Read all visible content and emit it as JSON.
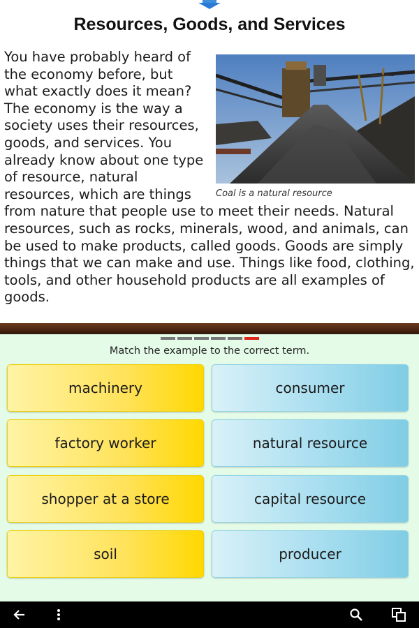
{
  "article": {
    "title": "Resources, Goods, and Services",
    "body": "You have probably heard of the economy before, but what exactly does it mean? The economy is the way a society uses their resources, goods, and services. You already know about one type of resource, natural resources, which are things from nature that people use to meet their needs. Natural resources, such as rocks, minerals, wood, and animals, can be used to make products, called goods. Goods are simply things that we can make and use. Things like food, clothing, tools, and other household products are all examples of goods.",
    "image_caption": "Coal is a natural resource"
  },
  "quiz": {
    "progress": {
      "total": 6,
      "current": 6
    },
    "instruction": "Match the example to the correct term.",
    "examples": [
      "machinery",
      "factory worker",
      "shopper at a store",
      "soil"
    ],
    "terms": [
      "consumer",
      "natural resource",
      "capital resource",
      "producer"
    ]
  },
  "colors": {
    "shelf": "#4a2410",
    "quiz_bg": "#e4fbe8",
    "example_card": "#ffe25a",
    "term_card": "#a8def0",
    "progress_active": "#e0261a"
  },
  "navbar": {
    "icons": [
      "back-icon",
      "menu-icon",
      "search-icon",
      "recent-apps-icon"
    ]
  }
}
